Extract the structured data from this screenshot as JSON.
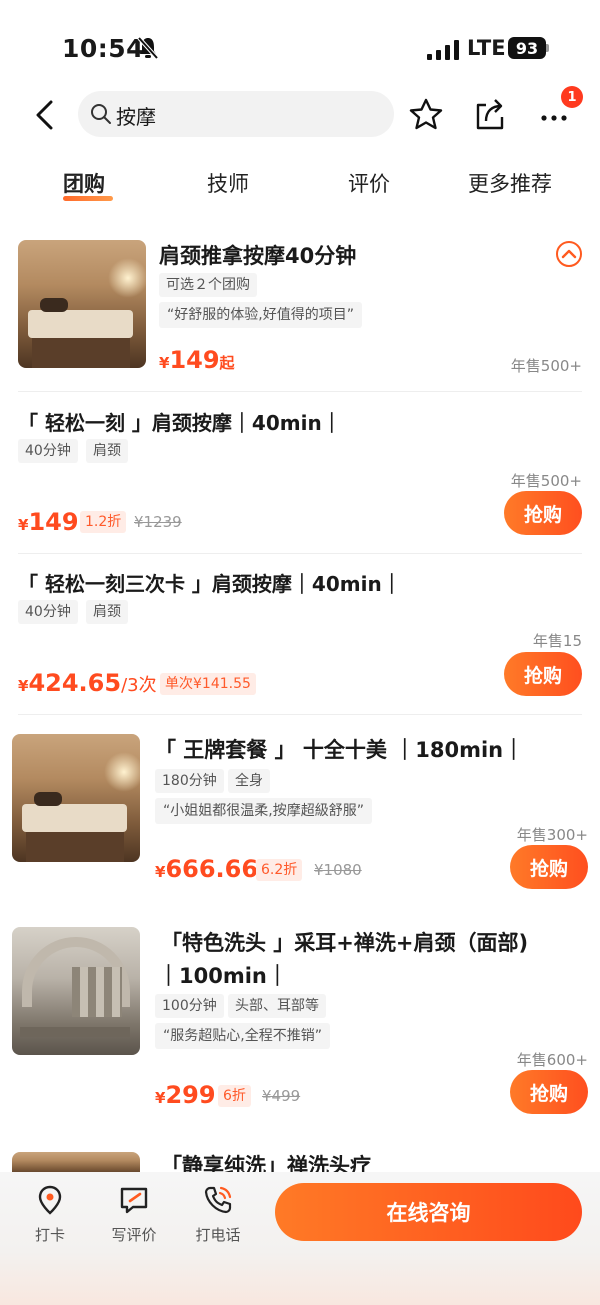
{
  "status_bar": {
    "time": "10:54",
    "network": "LTE",
    "battery": "93"
  },
  "header": {
    "search_text": "按摩",
    "more_badge": "1"
  },
  "tabs": [
    {
      "label": "团购"
    },
    {
      "label": "技师"
    },
    {
      "label": "评价"
    },
    {
      "label": "更多推荐"
    }
  ],
  "deal_group": {
    "title": "肩颈推拿按摩40分钟",
    "tag": "可选２个团购",
    "quote": "“好舒服的体验,好值得的项目”",
    "price_currency": "¥",
    "price": "149",
    "price_suffix": "起",
    "sales": "年售500+",
    "options": [
      {
        "title": "「 轻松一刻 」肩颈按摩｜40min｜",
        "tags": [
          "40分钟",
          "肩颈"
        ],
        "price_currency": "¥",
        "price": "149",
        "discount": "1.2折",
        "original_price": "¥1239",
        "sales": "年售500+",
        "buy_label": "抢购"
      },
      {
        "title": "「 轻松一刻三次卡 」肩颈按摩｜40min｜",
        "tags": [
          "40分钟",
          "肩颈"
        ],
        "price_currency": "¥",
        "price": "424.65",
        "price_per": "/3次",
        "discount": "单次¥141.55",
        "sales": "年售15",
        "buy_label": "抢购"
      }
    ]
  },
  "deals": [
    {
      "title": "「 王牌套餐 」 十全十美 ｜180min｜",
      "tags": [
        "180分钟",
        "全身"
      ],
      "quote": "“小姐姐都很温柔,按摩超級舒服”",
      "price_currency": "¥",
      "price": "666.66",
      "discount": "6.2折",
      "original_price": "¥1080",
      "sales": "年售300+",
      "buy_label": "抢购"
    },
    {
      "title_line1": "「特色洗头 」采耳+禅洗+肩颈（面部)",
      "title_line2": "｜100min｜",
      "tags": [
        "100分钟",
        "头部、耳部等"
      ],
      "quote": "“服务超贴心,全程不推销”",
      "price_currency": "¥",
      "price": "299",
      "discount": "6折",
      "original_price": "¥499",
      "sales": "年售600+",
      "buy_label": "抢购"
    },
    {
      "title": "「静享纯洗」禅洗头疗"
    }
  ],
  "bottom_bar": {
    "checkin": "打卡",
    "review": "写评价",
    "call": "打电话",
    "consult": "在线咨询"
  },
  "colors": {
    "accent": "#ff5a1f",
    "price": "#ff4b1f"
  }
}
